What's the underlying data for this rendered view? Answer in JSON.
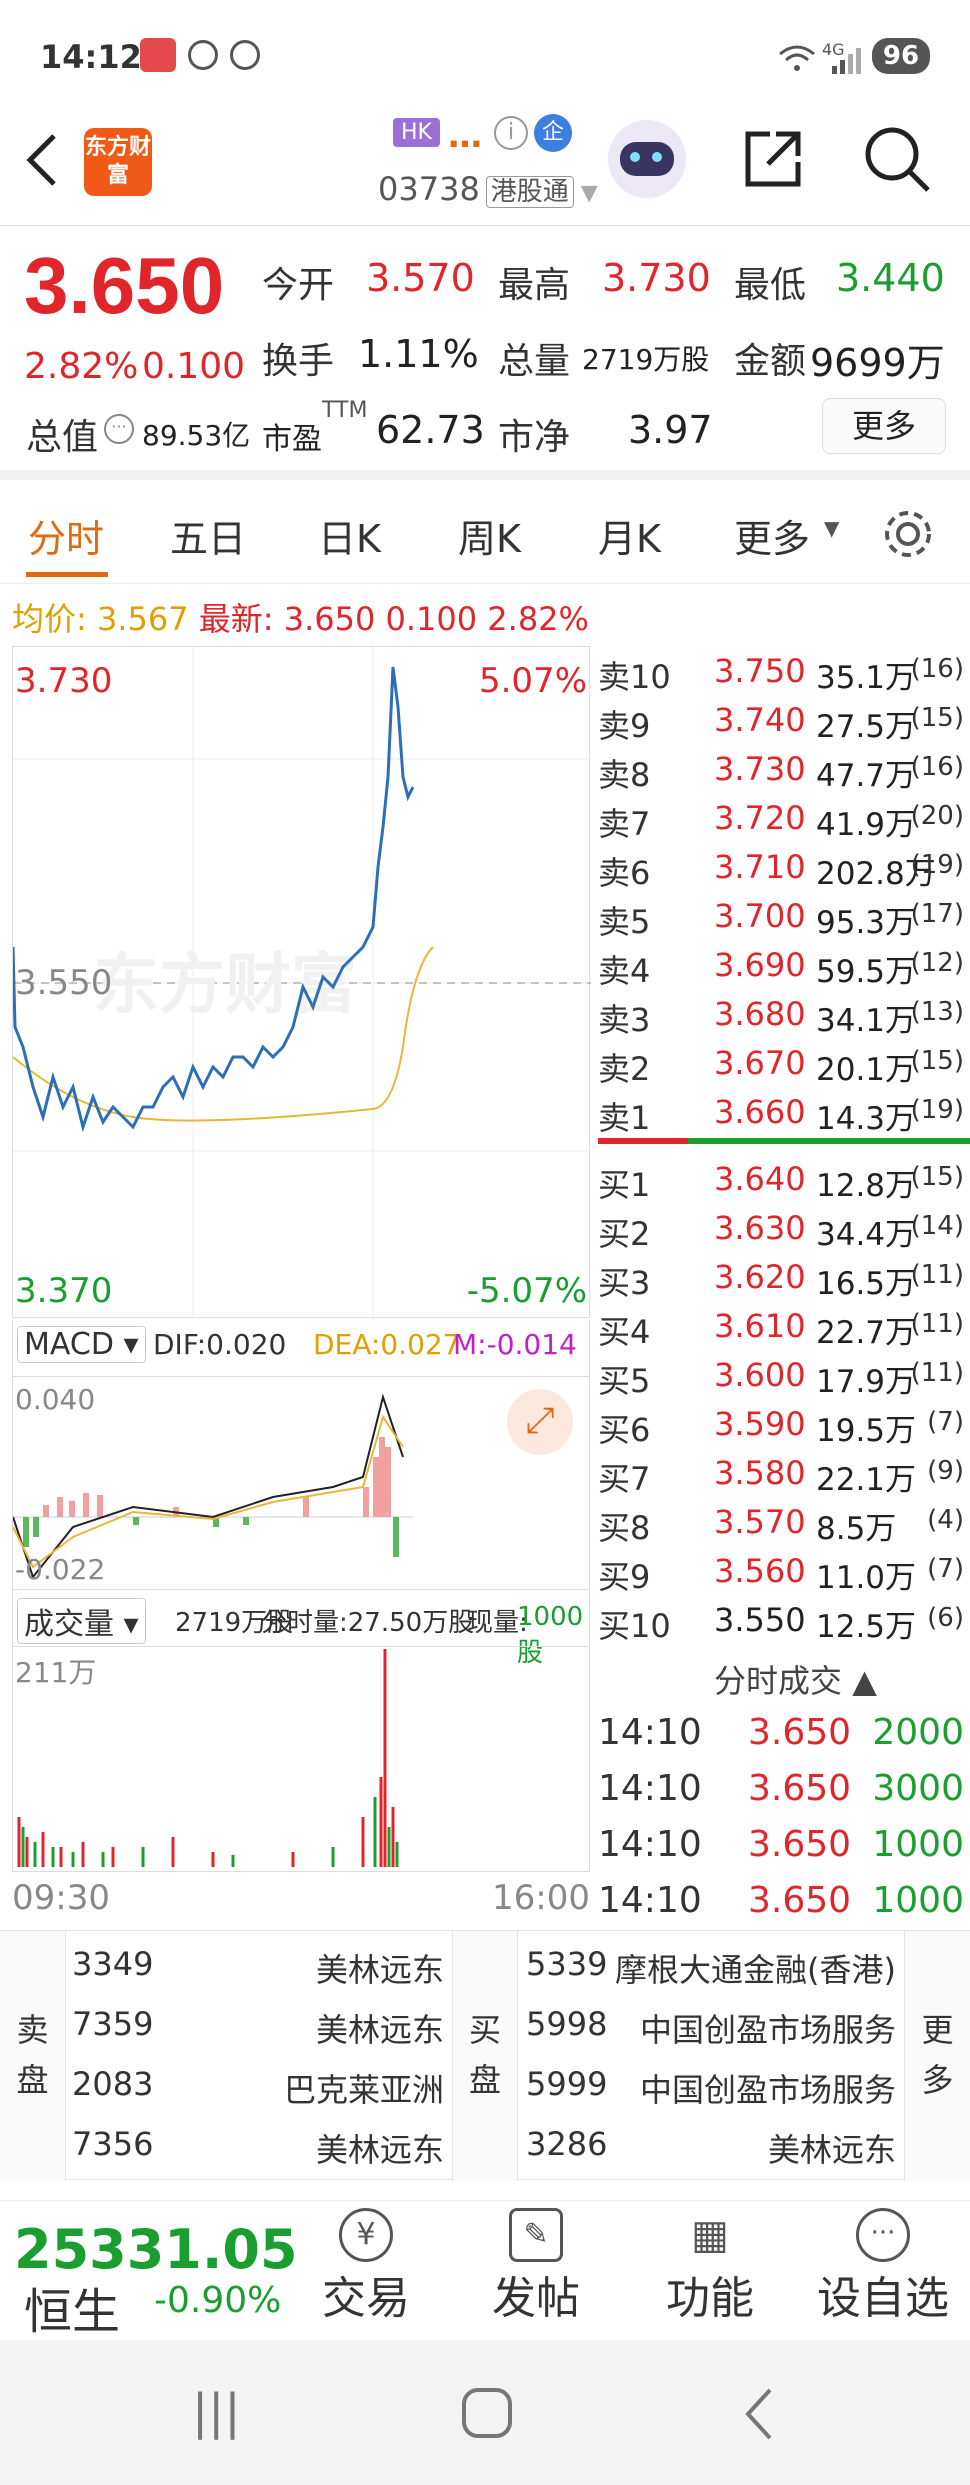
{
  "status": {
    "time": "14:12",
    "battery": "96",
    "net": "4G"
  },
  "header": {
    "back_label": "<",
    "logo_text": "东方财富",
    "market_badge": "HK",
    "name_ellipsis": "…",
    "code": "03738",
    "market": "港股通",
    "enterprise_badge": "企"
  },
  "quote": {
    "price": "3.650",
    "change_pct": "2.82%",
    "change": "0.100",
    "open_label": "今开",
    "open": "3.570",
    "high_label": "最高",
    "high": "3.730",
    "low_label": "最低",
    "low": "3.440",
    "turnover_label": "换手",
    "turnover": "1.11%",
    "volume_label": "总量",
    "volume": "2719万股",
    "amount_label": "金额",
    "amount": "9699万",
    "mcap_label": "总值",
    "mcap": "89.53亿",
    "pe_label": "市盈",
    "pe_sup": "TTM",
    "pe": "62.73",
    "pb_label": "市净",
    "pb": "3.97",
    "more_label": "更多"
  },
  "tabs": {
    "t1": "分时",
    "t2": "五日",
    "t3": "日K",
    "t4": "周K",
    "t5": "月K",
    "t6": "更多"
  },
  "avgline": {
    "avg_label": "均价:",
    "avg": "3.567",
    "last_label": "最新:",
    "last": "3.650",
    "chg": "0.100",
    "pct": "2.82%"
  },
  "chart": {
    "y_top": "3.730",
    "y_top_pct": "5.07%",
    "y_mid": "3.550",
    "y_bot": "3.370",
    "y_bot_pct": "-5.07%",
    "watermark": "东方财富",
    "macd_label": "MACD",
    "dif": "DIF:0.020",
    "dea": "DEA:0.027",
    "m": "M:-0.014",
    "macd_top": "0.040",
    "macd_bot": "-0.022",
    "vol_label": "成交量",
    "vol_total": "2719万股",
    "vol_min": "分时量:27.50万股",
    "vol_now_label": "现量:",
    "vol_now": "1000股",
    "vol_max": "211万",
    "t_start": "09:30",
    "t_end": "16:00"
  },
  "book": {
    "asks": [
      {
        "label": "卖10",
        "price": "3.750",
        "vol": "35.1万",
        "cnt": "(16)"
      },
      {
        "label": "卖9",
        "price": "3.740",
        "vol": "27.5万",
        "cnt": "(15)"
      },
      {
        "label": "卖8",
        "price": "3.730",
        "vol": "47.7万",
        "cnt": "(16)"
      },
      {
        "label": "卖7",
        "price": "3.720",
        "vol": "41.9万",
        "cnt": "(20)"
      },
      {
        "label": "卖6",
        "price": "3.710",
        "vol": "202.8万",
        "cnt": "(19)"
      },
      {
        "label": "卖5",
        "price": "3.700",
        "vol": "95.3万",
        "cnt": "(17)"
      },
      {
        "label": "卖4",
        "price": "3.690",
        "vol": "59.5万",
        "cnt": "(12)"
      },
      {
        "label": "卖3",
        "price": "3.680",
        "vol": "34.1万",
        "cnt": "(13)"
      },
      {
        "label": "卖2",
        "price": "3.670",
        "vol": "20.1万",
        "cnt": "(15)"
      },
      {
        "label": "卖1",
        "price": "3.660",
        "vol": "14.3万",
        "cnt": "(19)"
      }
    ],
    "bids": [
      {
        "label": "买1",
        "price": "3.640",
        "vol": "12.8万",
        "cnt": "(15)"
      },
      {
        "label": "买2",
        "price": "3.630",
        "vol": "34.4万",
        "cnt": "(14)"
      },
      {
        "label": "买3",
        "price": "3.620",
        "vol": "16.5万",
        "cnt": "(11)"
      },
      {
        "label": "买4",
        "price": "3.610",
        "vol": "22.7万",
        "cnt": "(11)"
      },
      {
        "label": "买5",
        "price": "3.600",
        "vol": "17.9万",
        "cnt": "(11)"
      },
      {
        "label": "买6",
        "price": "3.590",
        "vol": "19.5万",
        "cnt": "(7)"
      },
      {
        "label": "买7",
        "price": "3.580",
        "vol": "22.1万",
        "cnt": "(9)"
      },
      {
        "label": "买8",
        "price": "3.570",
        "vol": "8.5万",
        "cnt": "(4)"
      },
      {
        "label": "买9",
        "price": "3.560",
        "vol": "11.0万",
        "cnt": "(7)"
      },
      {
        "label": "买10",
        "price": "3.550",
        "vol": "12.5万",
        "cnt": "(6)"
      }
    ]
  },
  "ticks": {
    "title": "分时成交",
    "rows": [
      {
        "time": "14:10",
        "price": "3.650",
        "vol": "2000"
      },
      {
        "time": "14:10",
        "price": "3.650",
        "vol": "3000"
      },
      {
        "time": "14:10",
        "price": "3.650",
        "vol": "1000"
      },
      {
        "time": "14:10",
        "price": "3.650",
        "vol": "1000"
      }
    ]
  },
  "broker": {
    "sell_label": "卖盘",
    "buy_label": "买盘",
    "more_label": "更多",
    "sell": [
      {
        "id": "3349",
        "name": "美林远东"
      },
      {
        "id": "7359",
        "name": "美林远东"
      },
      {
        "id": "2083",
        "name": "巴克莱亚洲"
      },
      {
        "id": "7356",
        "name": "美林远东"
      }
    ],
    "buy": [
      {
        "id": "5339",
        "name": "摩根大通金融(香港)"
      },
      {
        "id": "5998",
        "name": "中国创盈市场服务"
      },
      {
        "id": "5999",
        "name": "中国创盈市场服务"
      },
      {
        "id": "3286",
        "name": "美林远东"
      }
    ]
  },
  "bottom": {
    "index_value": "25331.05",
    "index_name": "恒生",
    "index_pct": "-0.90%",
    "trade": "交易",
    "post": "发帖",
    "func": "功能",
    "watch": "设自选"
  },
  "colors": {
    "up": "#e0262b",
    "down": "#1a9e2f",
    "accent": "#e06a10",
    "price_line": "#2a6fb8",
    "avg_line": "#e8b73a"
  }
}
